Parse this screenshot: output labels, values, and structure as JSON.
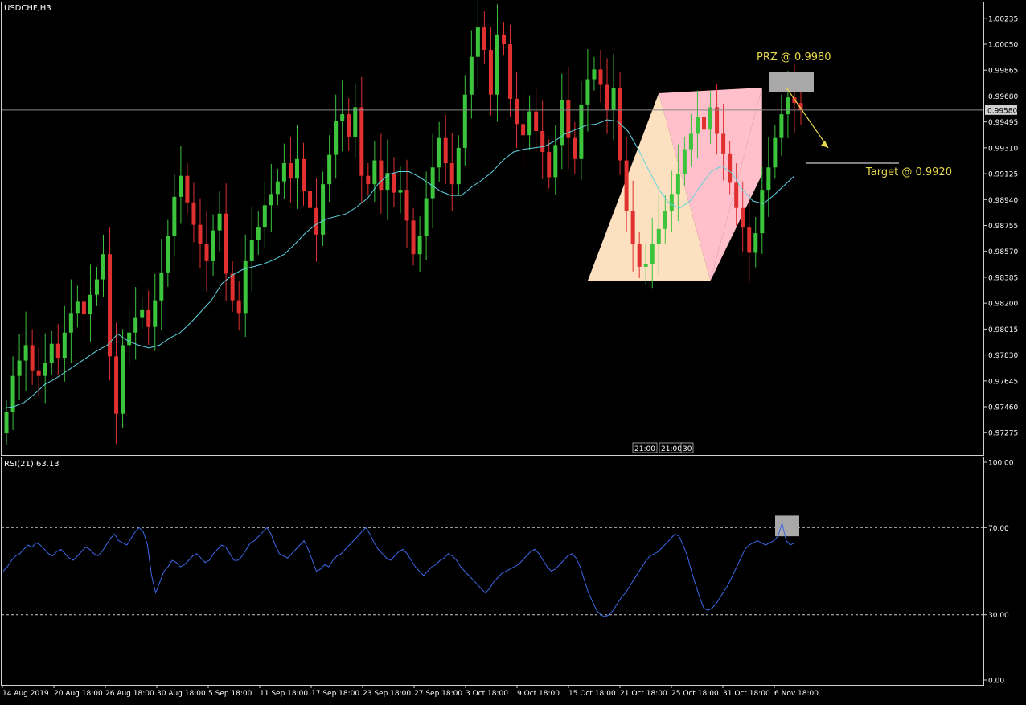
{
  "chart_data": [
    {
      "type": "candlestick",
      "title": "USDCHF,H3",
      "ylim": [
        0.9715,
        1.0032
      ],
      "y_ticks": [
        "1.00235",
        "1.00050",
        "0.99865",
        "0.99680",
        "0.99495",
        "0.99310",
        "0.99125",
        "0.98940",
        "0.98755",
        "0.98570",
        "0.98385",
        "0.98200",
        "0.98015",
        "0.97830",
        "0.97645",
        "0.97460",
        "0.97275"
      ],
      "current_price_label": "0.99580",
      "current_price": 0.9958,
      "moving_average_color": "#5fd3df",
      "up_candle_color": "#3cc43c",
      "down_candle_color": "#e03030",
      "close_series": [
        0.9742,
        0.9768,
        0.9779,
        0.979,
        0.9772,
        0.9768,
        0.9777,
        0.9791,
        0.9781,
        0.9799,
        0.9813,
        0.9821,
        0.9812,
        0.9826,
        0.9837,
        0.9855,
        0.9782,
        0.9741,
        0.979,
        0.9799,
        0.981,
        0.9815,
        0.9803,
        0.9822,
        0.9842,
        0.9868,
        0.9896,
        0.9911,
        0.9892,
        0.9876,
        0.9862,
        0.985,
        0.9872,
        0.9884,
        0.9841,
        0.9822,
        0.9813,
        0.985,
        0.9865,
        0.9874,
        0.989,
        0.9898,
        0.9907,
        0.992,
        0.9909,
        0.9923,
        0.99,
        0.9888,
        0.9869,
        0.9905,
        0.9926,
        0.995,
        0.9955,
        0.9939,
        0.996,
        0.9911,
        0.9905,
        0.9922,
        0.9901,
        0.9913,
        0.9899,
        0.9901,
        0.9879,
        0.9855,
        0.9868,
        0.9895,
        0.9917,
        0.9938,
        0.992,
        0.9905,
        0.9931,
        0.9969,
        0.9996,
        1.0017,
        1.0001,
        0.9969,
        1.0012,
        1.0005,
        0.9966,
        0.9948,
        0.994,
        0.9957,
        0.9943,
        0.9928,
        0.991,
        0.9933,
        0.9965,
        0.9938,
        0.9923,
        0.9962,
        0.998,
        0.9987,
        0.9976,
        0.9958,
        0.9974,
        0.9922,
        0.9886,
        0.9862,
        0.9846,
        0.9848,
        0.9862,
        0.9873,
        0.9886,
        0.9898,
        0.9912,
        0.993,
        0.9941,
        0.9953,
        0.9944,
        0.996,
        0.9941,
        0.9927,
        0.9906,
        0.9888,
        0.9874,
        0.9856,
        0.987,
        0.9901,
        0.9917,
        0.9938,
        0.9955,
        0.9967,
        0.9963,
        0.9958
      ],
      "ma_series": [
        0.9745,
        0.9746,
        0.9749,
        0.9755,
        0.9762,
        0.9766,
        0.9771,
        0.9776,
        0.9781,
        0.9786,
        0.979,
        0.9798,
        0.9793,
        0.979,
        0.9788,
        0.979,
        0.9795,
        0.9799,
        0.9806,
        0.9814,
        0.9822,
        0.9834,
        0.984,
        0.9844,
        0.9846,
        0.9848,
        0.9851,
        0.9855,
        0.9862,
        0.987,
        0.9876,
        0.988,
        0.9882,
        0.9884,
        0.9889,
        0.9895,
        0.9905,
        0.9912,
        0.9914,
        0.9914,
        0.991,
        0.9905,
        0.99,
        0.9897,
        0.9897,
        0.9903,
        0.9908,
        0.9914,
        0.9922,
        0.9928,
        0.993,
        0.9931,
        0.9932,
        0.9936,
        0.9941,
        0.9944,
        0.9947,
        0.9948,
        0.9951,
        0.995,
        0.9943,
        0.993,
        0.9915,
        0.9901,
        0.9891,
        0.9888,
        0.9893,
        0.9904,
        0.9914,
        0.9918,
        0.9913,
        0.9901,
        0.9893,
        0.9891,
        0.9897,
        0.9904,
        0.9911
      ],
      "harmonic_pattern": {
        "points": [
          {
            "time_index": 90,
            "price": 0.9836
          },
          {
            "time_index": 101,
            "price": 0.997
          },
          {
            "time_index": 109,
            "price": 0.9836
          },
          {
            "time_index": 117,
            "price": 0.9974
          }
        ],
        "right_wing_end": {
          "time_index": 117,
          "price": 0.9912
        },
        "left_fill_color": "#fde0c0",
        "right_fill_color": "#ffc0cb"
      },
      "prz_box": {
        "label": "PRZ @ 0.9980",
        "price_low": 0.9971,
        "price_high": 0.9985
      },
      "target": {
        "label": "Target @ 0.9920",
        "price": 0.992
      },
      "annotation_color": "#e8d84e",
      "time_markers": [
        "21:00",
        "21:00",
        "30"
      ]
    },
    {
      "type": "line",
      "title": "RSI(21) 63.13",
      "ylim": [
        0,
        100
      ],
      "y_ticks": [
        "100.00",
        "70.00",
        "30.00",
        "0.00"
      ],
      "levels": [
        70,
        30
      ],
      "line_color": "#3d68e8",
      "values": [
        50,
        52,
        55,
        57,
        58,
        60,
        62,
        61,
        63,
        62,
        60,
        58,
        57,
        59,
        60,
        58,
        56,
        55,
        57,
        59,
        61,
        60,
        58,
        57,
        59,
        62,
        65,
        67,
        64,
        63,
        62,
        65,
        68,
        70,
        68,
        62,
        48,
        40,
        45,
        50,
        52,
        55,
        54,
        52,
        53,
        55,
        57,
        58,
        56,
        54,
        55,
        58,
        60,
        62,
        61,
        58,
        55,
        55,
        57,
        60,
        63,
        64,
        66,
        68,
        70,
        67,
        62,
        58,
        57,
        56,
        58,
        60,
        62,
        64,
        60,
        55,
        50,
        51,
        53,
        52,
        55,
        57,
        58,
        60,
        62,
        64,
        66,
        68,
        70,
        67,
        63,
        60,
        58,
        56,
        55,
        57,
        59,
        60,
        58,
        55,
        52,
        50,
        48,
        50,
        52,
        53,
        55,
        56,
        58,
        57,
        55,
        52,
        50,
        48,
        46,
        44,
        42,
        40,
        42,
        45,
        47,
        49,
        50,
        51,
        52,
        53,
        55,
        57,
        59,
        60,
        58,
        55,
        52,
        50,
        51,
        53,
        55,
        57,
        58,
        56,
        52,
        46,
        40,
        36,
        32,
        30,
        29,
        30,
        32,
        35,
        38,
        40,
        43,
        46,
        49,
        52,
        55,
        57,
        58,
        59,
        61,
        63,
        65,
        67,
        66,
        62,
        57,
        50,
        44,
        38,
        33,
        32,
        33,
        35,
        38,
        41,
        44,
        48,
        52,
        56,
        60,
        62,
        63,
        64,
        63,
        62,
        63,
        64,
        66,
        72,
        64,
        62,
        63
      ]
    }
  ],
  "x_tick_labels": [
    "14 Aug 2019",
    "20 Aug 18:00",
    "26 Aug 18:00",
    "30 Aug 18:00",
    "5 Sep 18:00",
    "11 Sep 18:00",
    "17 Sep 18:00",
    "23 Sep 18:00",
    "27 Sep 18:00",
    "3 Oct 18:00",
    "9 Oct 18:00",
    "15 Oct 18:00",
    "21 Oct 18:00",
    "25 Oct 18:00",
    "31 Oct 18:00",
    "6 Nov 18:00"
  ],
  "highlight_color": "#a8a8a8"
}
